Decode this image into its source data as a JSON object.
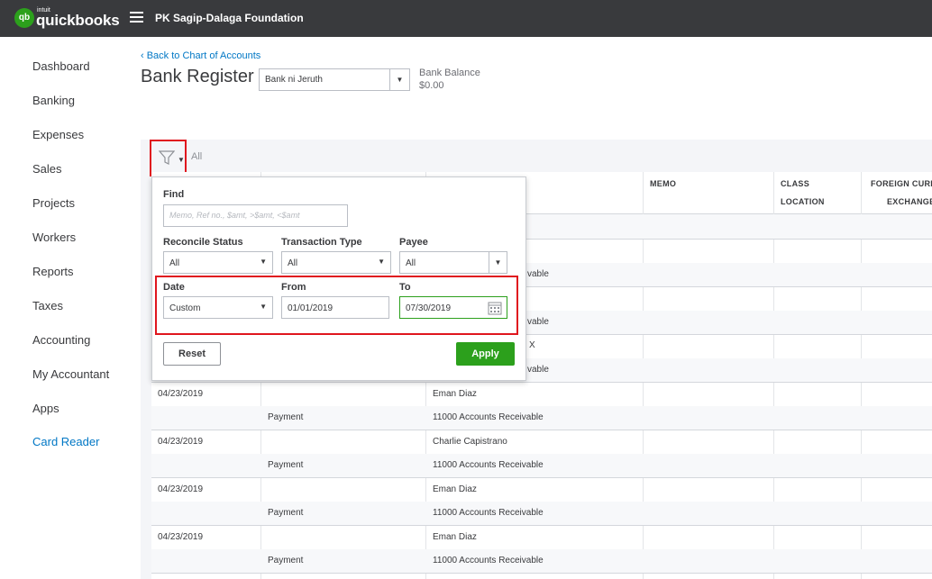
{
  "header": {
    "logo_text": "qb",
    "brand_small": "intuit",
    "brand": "quickbooks",
    "company": "PK Sagip-Dalaga Foundation"
  },
  "sidebar": {
    "items": [
      {
        "label": "Dashboard"
      },
      {
        "label": "Banking"
      },
      {
        "label": "Expenses"
      },
      {
        "label": "Sales"
      },
      {
        "label": "Projects"
      },
      {
        "label": "Workers"
      },
      {
        "label": "Reports"
      },
      {
        "label": "Taxes"
      },
      {
        "label": "Accounting"
      },
      {
        "label": "My Accountant"
      },
      {
        "label": "Apps"
      },
      {
        "label": "Card Reader"
      }
    ]
  },
  "register": {
    "back_link": "‹ Back to Chart of Accounts",
    "title": "Bank Register",
    "account": "Bank ni Jeruth",
    "balance_label": "Bank Balance",
    "balance_value": "$0.00",
    "filter_summary": "All"
  },
  "table": {
    "headers": {
      "memo": "MEMO",
      "class": "CLASS",
      "location": "LOCATION",
      "foreign": "FOREIGN CURR",
      "exchange": "EXCHANGE"
    },
    "partial": [
      {
        "account": "vable"
      },
      {
        "account": "vable"
      },
      {
        "payee": "X"
      },
      {
        "account": "vable"
      }
    ],
    "rows": [
      {
        "date": "04/23/2019",
        "payee": "Eman Diaz",
        "type": "Payment",
        "account": "11000 Accounts Receivable"
      },
      {
        "date": "04/23/2019",
        "payee": "Charlie Capistrano",
        "type": "Payment",
        "account": "11000 Accounts Receivable"
      },
      {
        "date": "04/23/2019",
        "payee": "Eman Diaz",
        "type": "Payment",
        "account": "11000 Accounts Receivable"
      },
      {
        "date": "04/23/2019",
        "payee": "Eman Diaz",
        "type": "Payment",
        "account": "11000 Accounts Receivable"
      }
    ]
  },
  "filter": {
    "find_label": "Find",
    "find_placeholder": "Memo, Ref no., $amt, >$amt, <$amt",
    "reconcile_label": "Reconcile Status",
    "reconcile_value": "All",
    "type_label": "Transaction Type",
    "type_value": "All",
    "payee_label": "Payee",
    "payee_value": "All",
    "date_label": "Date",
    "date_value": "Custom",
    "from_label": "From",
    "from_value": "01/01/2019",
    "to_label": "To",
    "to_value": "07/30/2019",
    "reset": "Reset",
    "apply": "Apply"
  },
  "colors": {
    "topbar": "#393a3d",
    "accent_green": "#2ca01c",
    "link_blue": "#0077c5",
    "highlight_red": "#e0161e"
  }
}
